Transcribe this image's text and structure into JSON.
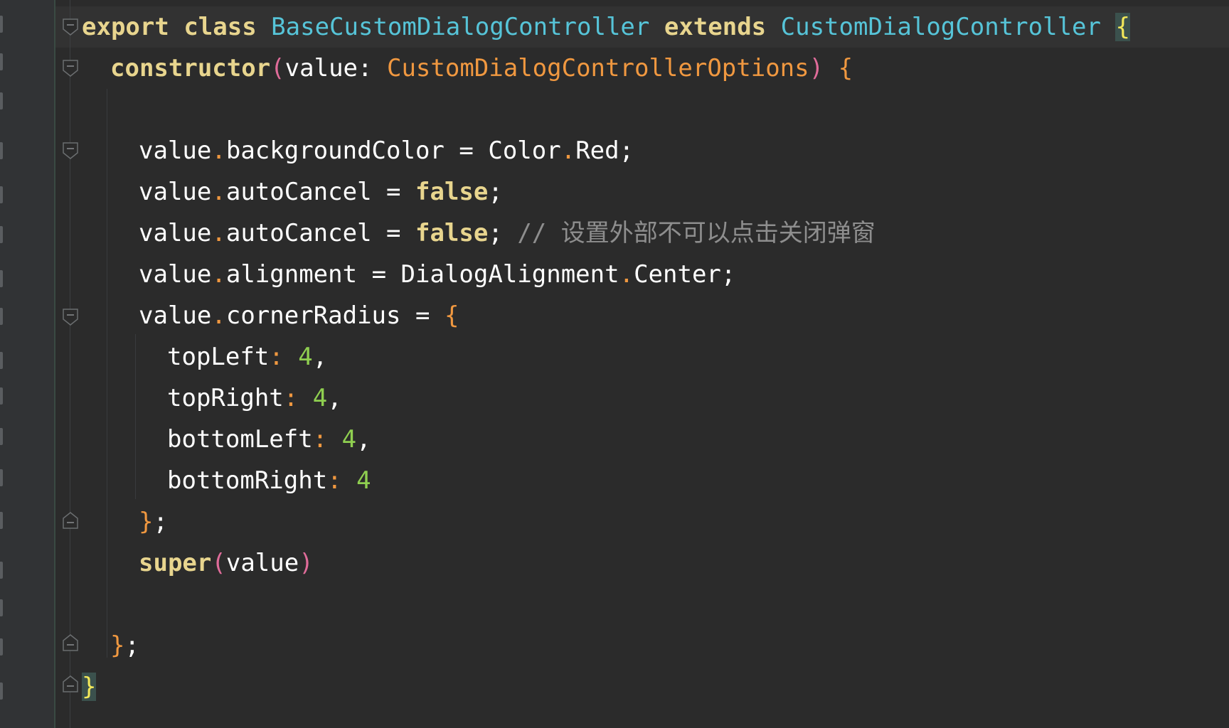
{
  "code": {
    "line1": {
      "export_kw": "export",
      "class_kw": "class",
      "class_name": "BaseCustomDialogController",
      "extends_kw": "extends",
      "super_class": "CustomDialogController",
      "open_brace": "{"
    },
    "line2": {
      "ctor_kw": "constructor",
      "open_paren": "(",
      "param": "value",
      "colon": ":",
      "param_type": "CustomDialogControllerOptions",
      "close_paren": ")",
      "open_brace": "{"
    },
    "line4": {
      "obj": "value",
      "dot": ".",
      "prop": "backgroundColor",
      "eq": "=",
      "rhs_obj": "Color",
      "rhs_dot": ".",
      "rhs_prop": "Red",
      "semi": ";"
    },
    "line5": {
      "obj": "value",
      "dot": ".",
      "prop": "autoCancel",
      "eq": "=",
      "bool": "false",
      "semi": ";"
    },
    "line6": {
      "obj": "value",
      "dot": ".",
      "prop": "autoCancel",
      "eq": "=",
      "bool": "false",
      "semi": ";",
      "comment_slashes": "//",
      "comment_text": "设置外部不可以点击关闭弹窗"
    },
    "line7": {
      "obj": "value",
      "dot": ".",
      "prop": "alignment",
      "eq": "=",
      "rhs_obj": "DialogAlignment",
      "rhs_dot": ".",
      "rhs_prop": "Center",
      "semi": ";"
    },
    "line8": {
      "obj": "value",
      "dot": ".",
      "prop": "cornerRadius",
      "eq": "=",
      "open_brace": "{"
    },
    "line9": {
      "key": "topLeft",
      "colon": ":",
      "value": "4",
      "comma": ","
    },
    "line10": {
      "key": "topRight",
      "colon": ":",
      "value": "4",
      "comma": ","
    },
    "line11": {
      "key": "bottomLeft",
      "colon": ":",
      "value": "4",
      "comma": ","
    },
    "line12": {
      "key": "bottomRight",
      "colon": ":",
      "value": "4"
    },
    "line13": {
      "close_brace": "}",
      "semi": ";"
    },
    "line14": {
      "super_kw": "super",
      "open_paren": "(",
      "arg": "value",
      "close_paren": ")"
    },
    "line16": {
      "close_brace": "}",
      "semi": ";"
    },
    "line17": {
      "close_brace": "}"
    }
  },
  "colors": {
    "background": "#2b2b2b",
    "keyword": "#e8d58e",
    "class_name": "#56c4d8",
    "type": "#f09840",
    "number": "#8fcf50",
    "comment": "#8e8e8e",
    "paren": "#e06c9a",
    "brace_match": "#f2e85a"
  },
  "icons": {
    "fold_open": "fold-open-icon",
    "fold_close": "fold-close-icon"
  }
}
